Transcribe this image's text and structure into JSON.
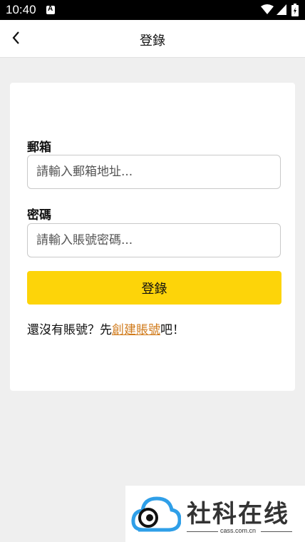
{
  "status_bar": {
    "time": "10:40",
    "notification_icon": "A"
  },
  "header": {
    "title": "登錄"
  },
  "form": {
    "email_label": "郵箱",
    "email_placeholder": "請輸入郵箱地址...",
    "password_label": "密碼",
    "password_placeholder": "請輸入賬號密碼...",
    "submit_label": "登錄"
  },
  "register": {
    "prefix": "還沒有賬號？先",
    "link_label": "創建賬號",
    "suffix": "吧！"
  },
  "watermark": {
    "brand": "社科在线",
    "site": "cass.com.cn"
  },
  "colors": {
    "accent": "#fdd409",
    "link": "#d07a1a",
    "watermark_blue": "#2f9fe8"
  }
}
